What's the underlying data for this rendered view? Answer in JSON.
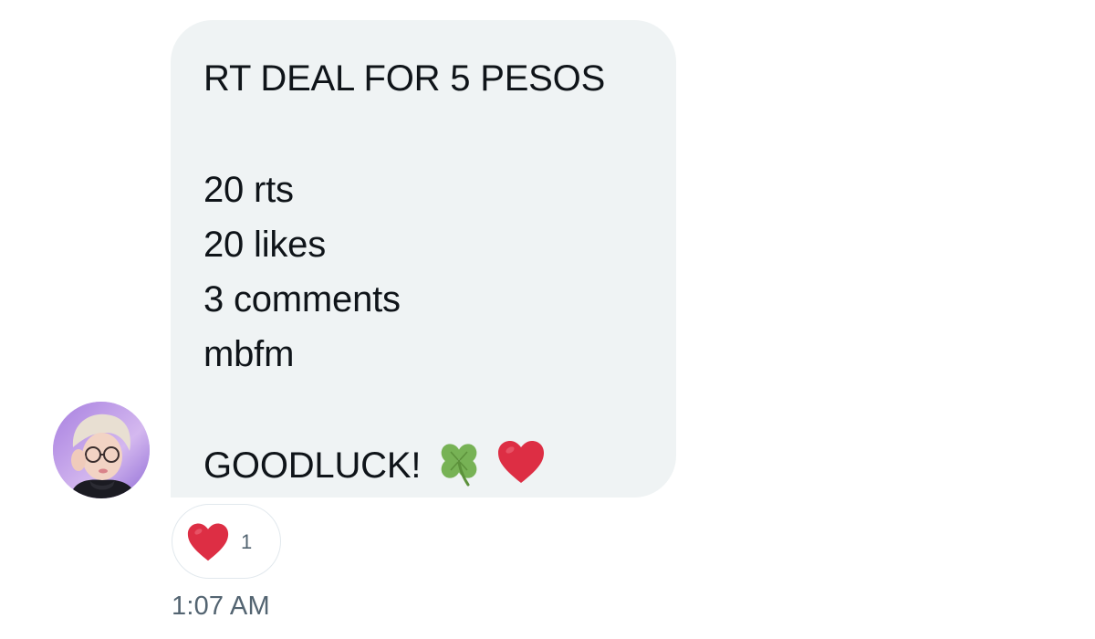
{
  "message": {
    "lines": [
      "RT DEAL FOR 5 PESOS",
      "",
      "20 rts",
      "20 likes",
      "3 comments",
      "mbfm",
      "",
      "GOODLUCK!"
    ],
    "trailing_emoji": [
      "four-leaf-clover-icon",
      "red-heart-icon"
    ]
  },
  "reaction": {
    "emoji": "red-heart-icon",
    "count": "1"
  },
  "timestamp": "1:07 AM",
  "colors": {
    "bubble_bg": "#eff3f4",
    "text": "#0f1419",
    "muted": "#536471",
    "heart": "#dd2e44",
    "clover": "#77b255",
    "avatar_bg": "#c9b3e8"
  }
}
